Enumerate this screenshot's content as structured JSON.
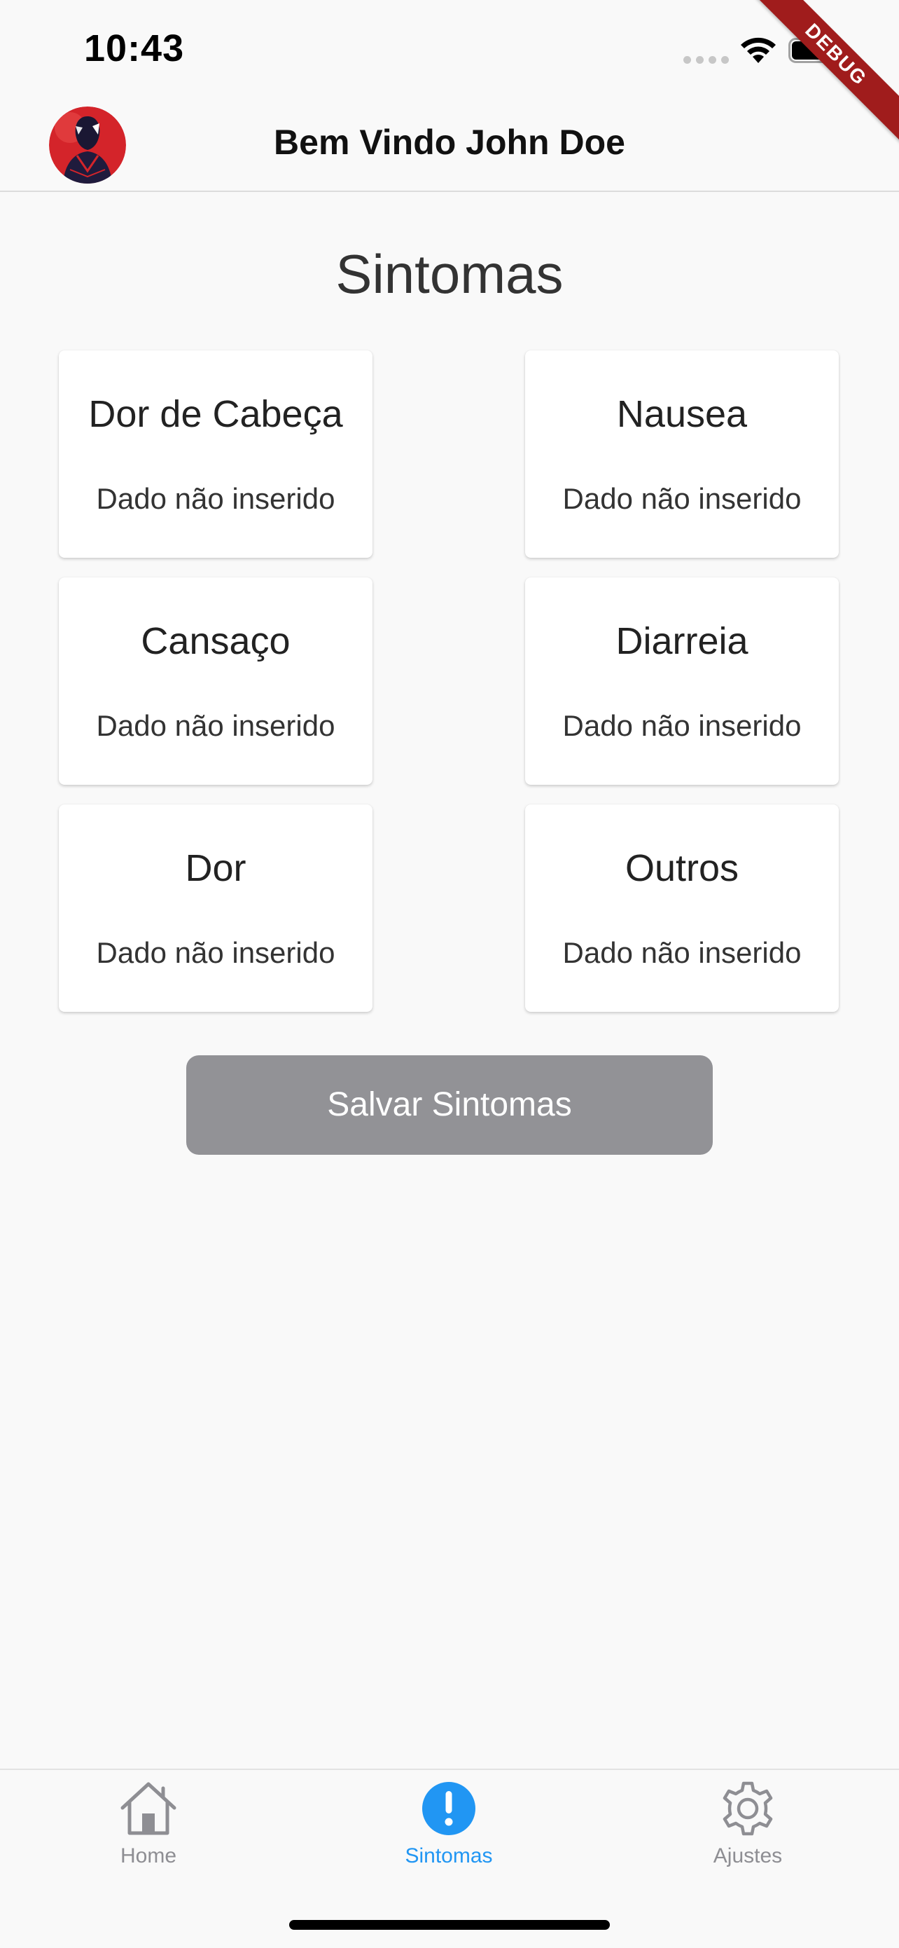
{
  "status_bar": {
    "time": "10:43"
  },
  "debug_banner": "DEBUG",
  "app_bar": {
    "title": "Bem Vindo John Doe",
    "avatar_icon": "spiderman-avatar"
  },
  "main": {
    "heading": "Sintomas",
    "cards": [
      {
        "title": "Dor de Cabeça",
        "status": "Dado não inserido"
      },
      {
        "title": "Nausea",
        "status": "Dado não inserido"
      },
      {
        "title": "Cansaço",
        "status": "Dado não inserido"
      },
      {
        "title": "Diarreia",
        "status": "Dado não inserido"
      },
      {
        "title": "Dor",
        "status": "Dado não inserido"
      },
      {
        "title": "Outros",
        "status": "Dado não inserido"
      }
    ],
    "save_button": "Salvar Sintomas"
  },
  "bottom_nav": {
    "items": [
      {
        "label": "Home",
        "icon": "home-icon",
        "active": false
      },
      {
        "label": "Sintomas",
        "icon": "alert-circle-icon",
        "active": true
      },
      {
        "label": "Ajustes",
        "icon": "gear-icon",
        "active": false
      }
    ]
  },
  "colors": {
    "background": "#f9f9f9",
    "accent": "#2196f3",
    "inactive": "#8e8e93",
    "button_disabled": "#929296",
    "debug_banner": "#a01c1c"
  }
}
